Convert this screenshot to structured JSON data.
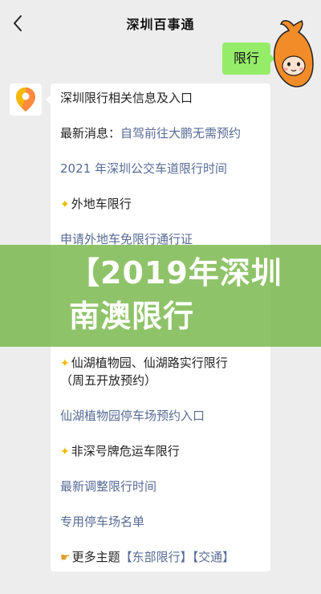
{
  "header": {
    "title": "深圳百事通",
    "back_icon": "chevron-left-icon"
  },
  "user_message": {
    "text": "限行"
  },
  "bot_message": {
    "lines": [
      {
        "text": "深圳限行相关信息及入口",
        "type": "plain"
      },
      {
        "prefix": "最新消息：",
        "link": "自驾前往大鹏无需预约",
        "type": "mixed"
      },
      {
        "text": "2021 年深圳公交车道限行时间",
        "type": "link"
      },
      {
        "text": "外地车限行",
        "type": "star"
      },
      {
        "text": "申请外地车免限行通行证",
        "type": "link"
      },
      {
        "text": "仙湖植物园、仙湖路实行限行",
        "type": "star"
      },
      {
        "text": "（周五开放预约）",
        "type": "plain"
      },
      {
        "text": "仙湖植物园停车场预约入口",
        "type": "link"
      },
      {
        "text": "非深号牌危运车限行",
        "type": "star"
      },
      {
        "text": "最新调整限行时间",
        "type": "link"
      },
      {
        "text": "专用停车场名单",
        "type": "link"
      },
      {
        "prefix": "更多主题",
        "link1": "【东部限行】",
        "link2": "【交通】",
        "type": "more"
      }
    ]
  },
  "overlay": {
    "text": "【2019年深圳南澳限行"
  },
  "colors": {
    "background": "#ededed",
    "user_bubble": "#95ec69",
    "link": "#576b95",
    "overlay": "#76b648"
  }
}
